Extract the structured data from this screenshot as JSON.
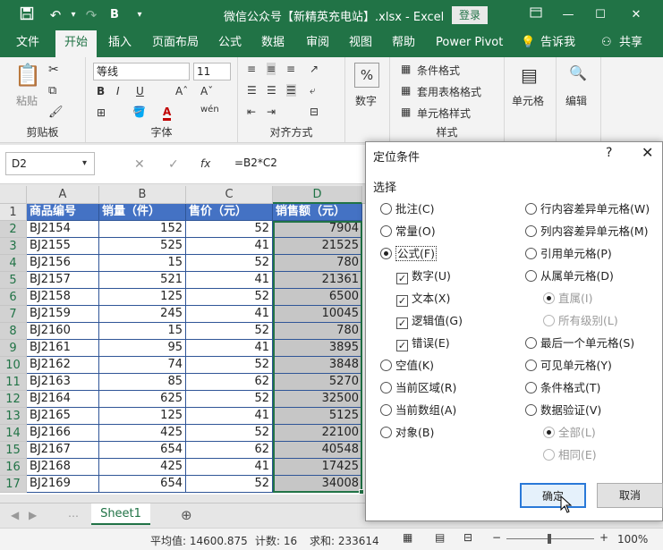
{
  "titlebar": {
    "title": "微信公众号【新精英充电站】.xlsx - Excel",
    "login": "登录",
    "save_icon": "save-icon",
    "bold_qat": "B"
  },
  "tabs": [
    "文件",
    "开始",
    "插入",
    "页面布局",
    "公式",
    "数据",
    "审阅",
    "视图",
    "帮助",
    "Power Pivot",
    "告诉我",
    "共享"
  ],
  "ribbon": {
    "clipboard": {
      "paste": "粘贴",
      "label": "剪贴板"
    },
    "font": {
      "name": "等线",
      "size": "11",
      "label": "字体",
      "bold": "B",
      "italic": "I",
      "underline": "U",
      "wen": "wén"
    },
    "alignment": {
      "label": "对齐方式"
    },
    "number": {
      "label": "数字",
      "symbol": "%"
    },
    "styles": {
      "cond_format": "条件格式",
      "table_format": "套用表格格式",
      "cell_styles": "单元格样式",
      "label": "样式"
    },
    "cells": {
      "label": "单元格"
    },
    "editing": {
      "label": "编辑"
    }
  },
  "formula_bar": {
    "name_box": "D2",
    "fx": "fx",
    "formula": "=B2*C2"
  },
  "sheet": {
    "columns": [
      "A",
      "B",
      "C",
      "D"
    ],
    "headers": [
      "商品编号",
      "销量（件）",
      "售价（元）",
      "销售额（元）"
    ],
    "rows": [
      [
        "BJ2154",
        "152",
        "52",
        "7904"
      ],
      [
        "BJ2155",
        "525",
        "41",
        "21525"
      ],
      [
        "BJ2156",
        "15",
        "52",
        "780"
      ],
      [
        "BJ2157",
        "521",
        "41",
        "21361"
      ],
      [
        "BJ2158",
        "125",
        "52",
        "6500"
      ],
      [
        "BJ2159",
        "245",
        "41",
        "10045"
      ],
      [
        "BJ2160",
        "15",
        "52",
        "780"
      ],
      [
        "BJ2161",
        "95",
        "41",
        "3895"
      ],
      [
        "BJ2162",
        "74",
        "52",
        "3848"
      ],
      [
        "BJ2163",
        "85",
        "62",
        "5270"
      ],
      [
        "BJ2164",
        "625",
        "52",
        "32500"
      ],
      [
        "BJ2165",
        "125",
        "41",
        "5125"
      ],
      [
        "BJ2166",
        "425",
        "52",
        "22100"
      ],
      [
        "BJ2167",
        "654",
        "62",
        "40548"
      ],
      [
        "BJ2168",
        "425",
        "41",
        "17425"
      ],
      [
        "BJ2169",
        "654",
        "52",
        "34008"
      ]
    ],
    "row_numbers": [
      "1",
      "2",
      "3",
      "4",
      "5",
      "6",
      "7",
      "8",
      "9",
      "10",
      "11",
      "12",
      "13",
      "14",
      "15",
      "16",
      "17"
    ],
    "tab": "Sheet1"
  },
  "status": {
    "average": "平均值: 14600.875",
    "count": "计数: 16",
    "sum": "求和: 233614",
    "zoom": "100%"
  },
  "dialog": {
    "title": "定位条件",
    "help": "?",
    "close": "✕",
    "section": "选择",
    "left": [
      {
        "label": "批注(C)",
        "kind": "radio",
        "checked": false
      },
      {
        "label": "常量(O)",
        "kind": "radio",
        "checked": false
      },
      {
        "label": "公式(F)",
        "kind": "radio",
        "checked": true
      },
      {
        "label": "数字(U)",
        "kind": "check",
        "checked": true
      },
      {
        "label": "文本(X)",
        "kind": "check",
        "checked": true
      },
      {
        "label": "逻辑值(G)",
        "kind": "check",
        "checked": true
      },
      {
        "label": "错误(E)",
        "kind": "check",
        "checked": true
      },
      {
        "label": "空值(K)",
        "kind": "radio",
        "checked": false
      },
      {
        "label": "当前区域(R)",
        "kind": "radio",
        "checked": false
      },
      {
        "label": "当前数组(A)",
        "kind": "radio",
        "checked": false
      },
      {
        "label": "对象(B)",
        "kind": "radio",
        "checked": false
      }
    ],
    "right": [
      {
        "label": "行内容差异单元格(W)",
        "kind": "radio",
        "checked": false
      },
      {
        "label": "列内容差异单元格(M)",
        "kind": "radio",
        "checked": false
      },
      {
        "label": "引用单元格(P)",
        "kind": "radio",
        "checked": false
      },
      {
        "label": "从属单元格(D)",
        "kind": "radio",
        "checked": false
      },
      {
        "label": "直属(I)",
        "kind": "radio-dis",
        "checked": true
      },
      {
        "label": "所有级别(L)",
        "kind": "radio-dis",
        "checked": false
      },
      {
        "label": "最后一个单元格(S)",
        "kind": "radio",
        "checked": false
      },
      {
        "label": "可见单元格(Y)",
        "kind": "radio",
        "checked": false
      },
      {
        "label": "条件格式(T)",
        "kind": "radio",
        "checked": false
      },
      {
        "label": "数据验证(V)",
        "kind": "radio",
        "checked": false
      },
      {
        "label": "全部(L)",
        "kind": "radio-dis",
        "checked": true
      },
      {
        "label": "相同(E)",
        "kind": "radio-dis",
        "checked": false
      }
    ],
    "ok": "确定",
    "cancel": "取消"
  },
  "colors": {
    "excel_green": "#217346",
    "table_header": "#4472c4",
    "table_border": "#2f5597",
    "selection_shade": "#c6c6c6"
  }
}
